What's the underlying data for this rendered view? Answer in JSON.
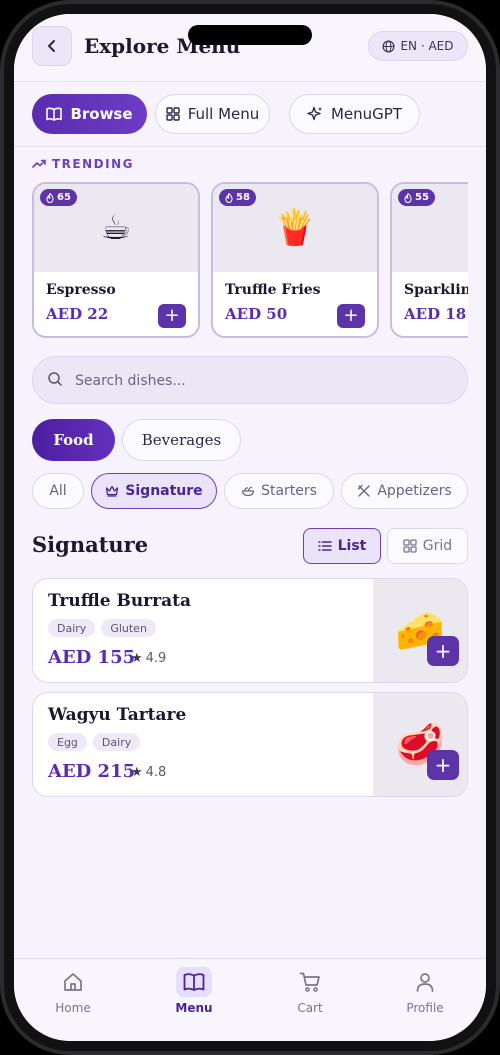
{
  "header": {
    "title": "Explore Menu",
    "lang_label": "EN · AED"
  },
  "mode_tabs": [
    {
      "label": "Browse",
      "icon": "book-icon",
      "active": true
    },
    {
      "label": "Full Menu",
      "icon": "grid-icon",
      "active": false
    },
    {
      "label": "MenuGPT",
      "icon": "sparkle-icon",
      "active": false
    }
  ],
  "trending": {
    "label": "TRENDING",
    "items": [
      {
        "name": "Espresso",
        "price": "AED 22",
        "count": "65",
        "emoji": "☕"
      },
      {
        "name": "Truffle Fries",
        "price": "AED 50",
        "count": "58",
        "emoji": "🍟"
      },
      {
        "name": "Sparkling",
        "price": "AED 18",
        "count": "55",
        "emoji": "💧"
      }
    ]
  },
  "search": {
    "placeholder": "Search dishes..."
  },
  "categories": [
    {
      "label": "Food",
      "active": true
    },
    {
      "label": "Beverages",
      "active": false
    }
  ],
  "filters": [
    {
      "label": "All",
      "active": false
    },
    {
      "label": "Signature",
      "active": true
    },
    {
      "label": "Starters",
      "active": false
    },
    {
      "label": "Appetizers",
      "active": false
    }
  ],
  "section": {
    "title": "Signature",
    "list_label": "List",
    "grid_label": "Grid",
    "view": "list"
  },
  "dishes": [
    {
      "name": "Truffle Burrata",
      "tags": [
        "Dairy",
        "Gluten"
      ],
      "price": "AED 155",
      "rating": "4.9",
      "emoji": "🧀"
    },
    {
      "name": "Wagyu Tartare",
      "tags": [
        "Egg",
        "Dairy"
      ],
      "price": "AED 215",
      "rating": "4.8",
      "emoji": "🥩"
    }
  ],
  "bottom_nav": [
    {
      "label": "Home",
      "icon": "home-icon",
      "active": false
    },
    {
      "label": "Menu",
      "icon": "book-icon",
      "active": true
    },
    {
      "label": "Cart",
      "icon": "cart-icon",
      "active": false
    },
    {
      "label": "Profile",
      "icon": "user-icon",
      "active": false
    }
  ],
  "colors": {
    "accent": "#5d34a8",
    "background": "#f6f3fc"
  }
}
